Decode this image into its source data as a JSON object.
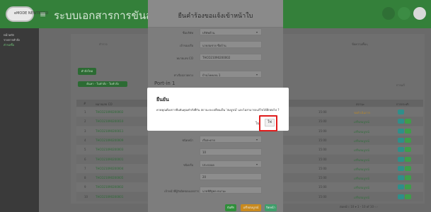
{
  "app": {
    "logo_text": "eMODE NEWTEKKO",
    "title": "ระบบเอกสารการขันส่งใบ",
    "panel_header_center": "ตำรวจ",
    "panel_header_right": "ข้อความคิ้นๆ"
  },
  "sidebar": {
    "items": [
      "หน้าหลัก",
      "รายการคำสั่ง",
      "คำขอซื้อ"
    ]
  },
  "table": {
    "add_button": "คำสั่งใหม่",
    "filter_tabs": "ค้นหา · ใบคำสั่ง · ใบคำสั่ง",
    "right_header": "การแก้",
    "columns": [
      "#",
      "หมายเลข CO",
      "สถานะ",
      "การกระทำ"
    ],
    "rows": [
      {
        "num": "1",
        "code": "THCO21090200002",
        "status": "รอดำเนินการ",
        "time": "15:00"
      },
      {
        "num": "2",
        "code": "THCO21090200010",
        "status": "เสร็จสมบูรณ์",
        "time": "15:00"
      },
      {
        "num": "3",
        "code": "THCO21090200011",
        "status": "เสร็จสมบูรณ์",
        "time": "15:00"
      },
      {
        "num": "4",
        "code": "THCO21090200009",
        "status": "เสร็จสมบูรณ์",
        "time": "15:00"
      },
      {
        "num": "5",
        "code": "THCO21090200003",
        "status": "เสร็จสมบูรณ์",
        "time": "15:00"
      },
      {
        "num": "6",
        "code": "THCO21090200001",
        "status": "เสร็จสมบูรณ์",
        "time": "15:00"
      },
      {
        "num": "7",
        "code": "THCO21090200004",
        "status": "เสร็จสมบูรณ์",
        "time": "15:00"
      },
      {
        "num": "8",
        "code": "THCO21090200005",
        "status": "เสร็จสมบูรณ์",
        "time": "15:00"
      },
      {
        "num": "9",
        "code": "THCO21090200002",
        "status": "เสร็จสมบูรณ์",
        "time": "15:00"
      },
      {
        "num": "10",
        "code": "THCO21090200001",
        "status": "เสร็จสมบูรณ์",
        "time": "15:00"
      }
    ],
    "pagination": "ต่อหน้า: 10 ▾   1 - 10 of 10   ‹  ›"
  },
  "form": {
    "title": "ยืนคำร้องขอแจ้งเข้าหน้าใบ",
    "fields": [
      {
        "label": "ชื่อบริษัท",
        "value": "บริษัทด้าน"
      },
      {
        "label": "เจ้าของเรือ",
        "value": "นายสมชาย ชื่อบ้าน"
      },
      {
        "label": "หมายเลข CO",
        "value": "THCO21090200002"
      }
    ],
    "part_title": "Port-in 1",
    "part_field": {
      "label": "ท่าเรือปลายทาง",
      "value": "บ้านโคคเลน 1"
    },
    "lower_fields": [
      {
        "label": "ชนิดหน้า",
        "value": "เรือสะดาย"
      },
      {
        "label": "",
        "value": "10"
      },
      {
        "label": "ชนิดเรือ",
        "value": "ประกอบด"
      },
      {
        "label": "",
        "value": "20"
      },
      {
        "label": "เจ้าหน้าที่ผู้รับผิดชอบเอกสาร",
        "value": "นายพิสิฐพล ธนานะ"
      }
    ],
    "footer_buttons": [
      "บันทึก",
      "เสร็จสมบูรณ์",
      "ปิดหน้า"
    ]
  },
  "dialog": {
    "title": "ยืนยัน",
    "message": "คาดคุณต้องการยืนยันคุณคำสั่งที่กัน สถานะจะเปลี่ยนเป็น 'สมบูรณ์' และไม่สามารถแก้ไขได้อีกต่อไป ?",
    "cancel_label": "ไม่",
    "confirm_label": "ใช่"
  },
  "colors": {
    "brand_green": "#34803a",
    "highlight_red": "#e01b1b"
  }
}
